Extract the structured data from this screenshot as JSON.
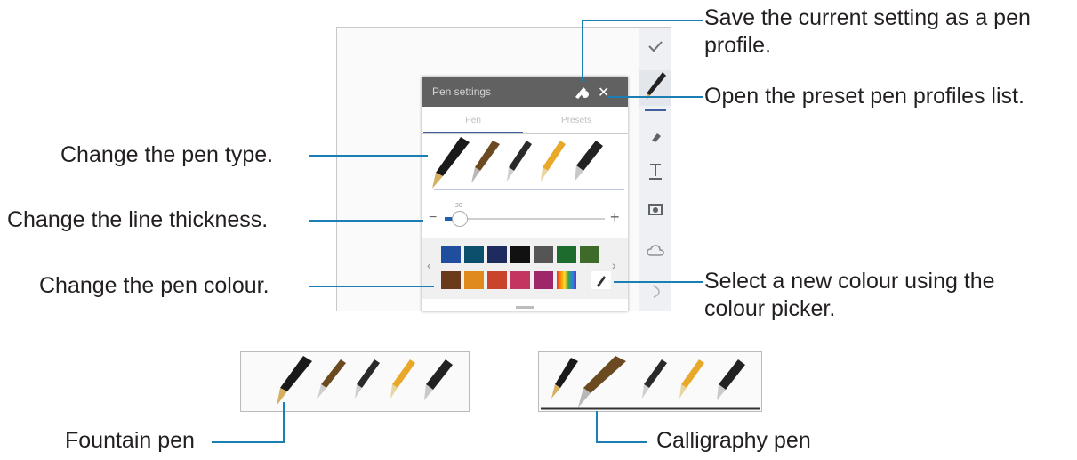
{
  "callouts": {
    "save_profile": "Save the current setting as a pen profile.",
    "preset_list": "Open the preset pen profiles list.",
    "pen_type": "Change the pen type.",
    "line_thickness": "Change the line thickness.",
    "pen_colour": "Change the pen colour.",
    "colour_picker": "Select a new colour using the colour picker.",
    "fountain_pen": "Fountain pen",
    "calligraphy_pen": "Calligraphy pen"
  },
  "panel": {
    "title": "Pen settings",
    "tabs": [
      "Pen",
      "Presets"
    ],
    "thickness_value": "20"
  },
  "toolbar_icons": [
    "check-icon",
    "pen-icon",
    "eraser-icon",
    "text-icon",
    "image-icon",
    "cloud-icon",
    "undo-icon"
  ],
  "palette_row1": [
    "#1f4e9e",
    "#0b4f6c",
    "#1e2b5f",
    "#111111",
    "#555555",
    "#1e6b2e",
    "#3f6b2a"
  ],
  "palette_row2": [
    "#6b3a1a",
    "#e08a1e",
    "#c8442a",
    "#c23660",
    "#a0266a",
    "rainbow"
  ],
  "accent": "#1b7fb3"
}
